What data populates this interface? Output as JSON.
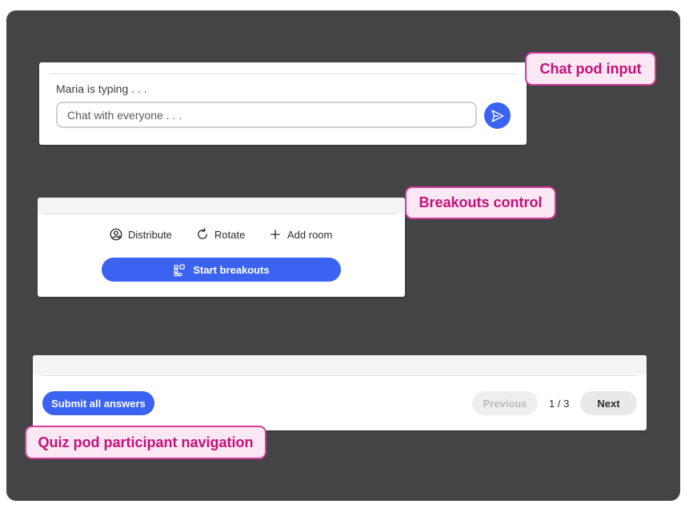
{
  "chat_pod": {
    "typing_status": "Maria is typing . . .",
    "input_placeholder": "Chat with everyone . . .",
    "send_icon": "send-icon",
    "callout_label": "Chat pod input"
  },
  "breakouts": {
    "tools": [
      {
        "label": "Distribute",
        "icon": "distribute-icon"
      },
      {
        "label": "Rotate",
        "icon": "rotate-icon"
      },
      {
        "label": "Add room",
        "icon": "plus-icon"
      }
    ],
    "start_label": "Start breakouts",
    "start_icon": "breakouts-icon",
    "callout_label": "Breakouts control"
  },
  "quiz": {
    "submit_label": "Submit all answers",
    "previous_label": "Previous",
    "page_indicator": "1 / 3",
    "next_label": "Next",
    "callout_label": "Quiz pod participant navigation"
  },
  "colors": {
    "accent_blue": "#3b63f1",
    "callout_pink": "#c2117a",
    "callout_bg": "#fce8f3",
    "stage_bg": "#444444"
  }
}
